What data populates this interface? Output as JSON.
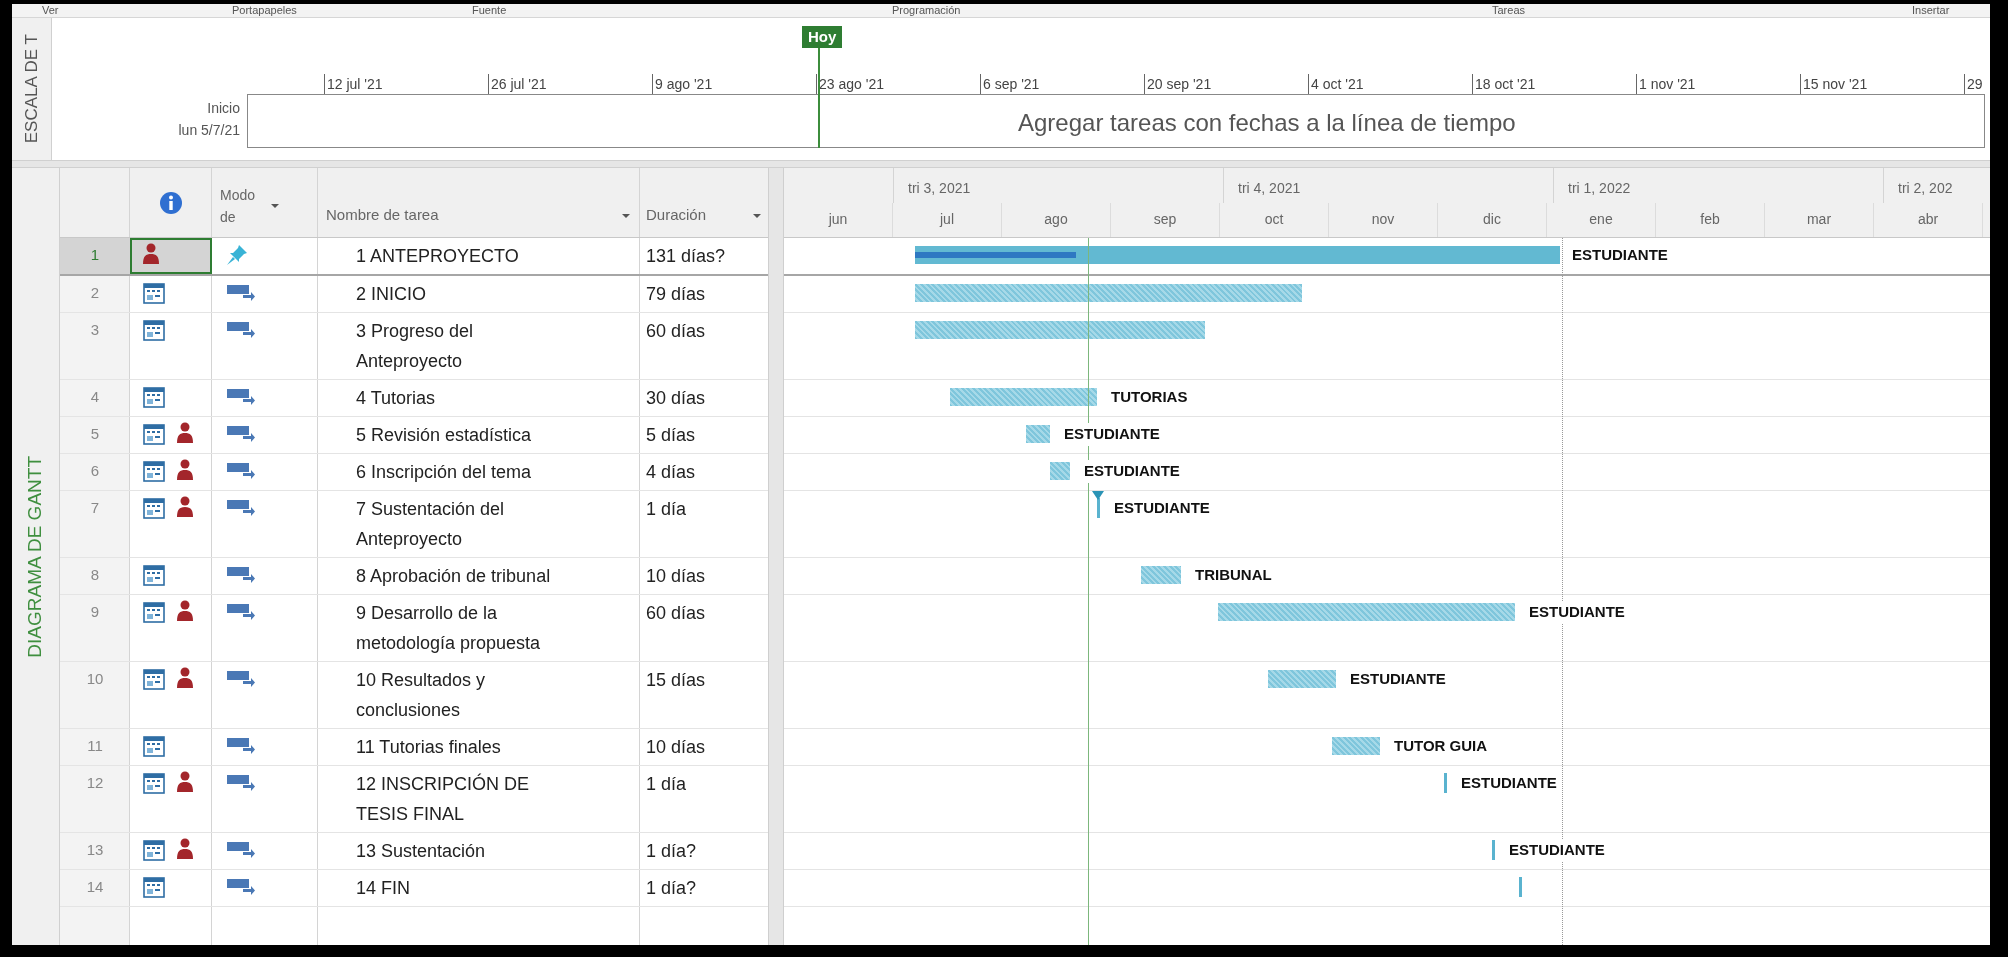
{
  "ribbon": {
    "groups": [
      "Ver",
      "Portapapeles",
      "Fuente",
      "Programación",
      "Tareas",
      "Insertar"
    ]
  },
  "timeline": {
    "side_label": "ESCALA DE T",
    "today_label": "Hoy",
    "start_label": "Inicio",
    "start_date": "lun 5/7/21",
    "ticks": [
      "12 jul '21",
      "26 jul '21",
      "9 ago '21",
      "23 ago '21",
      "6 sep '21",
      "20 sep '21",
      "4 oct '21",
      "18 oct '21",
      "1 nov '21",
      "15 nov '21",
      "29"
    ],
    "placeholder": "Agregar tareas con fechas a la línea de tiempo"
  },
  "table": {
    "side_label": "DIAGRAMA DE GANTT",
    "columns": {
      "mode": "Modo de",
      "name": "Nombre de tarea",
      "duration": "Duración"
    },
    "rows": [
      {
        "number": "1",
        "name": "1 ANTEPROYECTO",
        "duration": "131 días?",
        "selected": true,
        "mode": {
          "kind": "manual"
        },
        "calendar": false,
        "resource_icon": true,
        "kind": "summary",
        "resource": "ESTUDIANTE",
        "progress": {
          "level": 0.25
        }
      },
      {
        "number": "2",
        "name": "2 INICIO",
        "duration": "79 días",
        "selected": false,
        "mode": {
          "kind": "auto"
        },
        "calendar": true,
        "resource_icon": false,
        "kind": "task"
      },
      {
        "number": "3",
        "name": "3 Progreso del Anteproyecto",
        "duration": "60 días",
        "selected": false,
        "mode": {
          "kind": "auto"
        },
        "calendar": true,
        "resource_icon": false,
        "kind": "task"
      },
      {
        "number": "4",
        "name": "4 Tutorias",
        "duration": "30 días",
        "selected": false,
        "mode": {
          "kind": "auto"
        },
        "calendar": true,
        "resource_icon": false,
        "kind": "task",
        "resource": "TUTORIAS"
      },
      {
        "number": "5",
        "name": "5 Revisión estadística",
        "duration": "5 días",
        "selected": false,
        "mode": {
          "kind": "auto"
        },
        "calendar": true,
        "resource_icon": true,
        "kind": "task",
        "resource": "ESTUDIANTE"
      },
      {
        "number": "6",
        "name": "6 Inscripción del tema",
        "duration": "4 días",
        "selected": false,
        "mode": {
          "kind": "auto"
        },
        "calendar": true,
        "resource_icon": true,
        "kind": "task",
        "resource": "ESTUDIANTE"
      },
      {
        "number": "7",
        "name": "7 Sustentación del Anteproyecto",
        "duration": "1 día",
        "selected": false,
        "mode": {
          "kind": "auto"
        },
        "calendar": true,
        "resource_icon": true,
        "kind": "task",
        "resource": "ESTUDIANTE"
      },
      {
        "number": "8",
        "name": "8 Aprobación de tribunal",
        "duration": "10 días",
        "selected": false,
        "mode": {
          "kind": "auto"
        },
        "calendar": true,
        "resource_icon": false,
        "kind": "task",
        "resource": "TRIBUNAL"
      },
      {
        "number": "9",
        "name": "9 Desarrollo de la metodología propuesta",
        "duration": "60 días",
        "selected": false,
        "mode": {
          "kind": "auto"
        },
        "calendar": true,
        "resource_icon": true,
        "kind": "task",
        "resource": "ESTUDIANTE"
      },
      {
        "number": "10",
        "name": "10 Resultados y conclusiones",
        "duration": "15 días",
        "selected": false,
        "mode": {
          "kind": "auto"
        },
        "calendar": true,
        "resource_icon": true,
        "kind": "task",
        "resource": "ESTUDIANTE"
      },
      {
        "number": "11",
        "name": "11 Tutorias finales",
        "duration": "10 días",
        "selected": false,
        "mode": {
          "kind": "auto"
        },
        "calendar": true,
        "resource_icon": false,
        "kind": "task",
        "resource": "TUTOR GUIA"
      },
      {
        "number": "12",
        "name": "12 INSCRIPCIÓN DE TESIS FINAL",
        "duration": "1 día",
        "selected": false,
        "mode": {
          "kind": "auto"
        },
        "calendar": true,
        "resource_icon": true,
        "kind": "task",
        "resource": "ESTUDIANTE"
      },
      {
        "number": "13",
        "name": "13 Sustentación",
        "duration": "1 día?",
        "selected": false,
        "mode": {
          "kind": "auto"
        },
        "calendar": true,
        "resource_icon": true,
        "kind": "task",
        "resource": "ESTUDIANTE"
      },
      {
        "number": "14",
        "name": "14 FIN",
        "duration": "1 día?",
        "selected": false,
        "mode": {
          "kind": "auto"
        },
        "calendar": true,
        "resource_icon": false,
        "kind": "task"
      }
    ]
  },
  "chart": {
    "quarters": [
      "tri 3, 2021",
      "tri 4, 2021",
      "tri 1, 2022",
      "tri 2, 202"
    ],
    "months": [
      "jun",
      "jul",
      "ago",
      "sep",
      "oct",
      "nov",
      "dic",
      "ene",
      "feb",
      "mar",
      "abr"
    ]
  }
}
